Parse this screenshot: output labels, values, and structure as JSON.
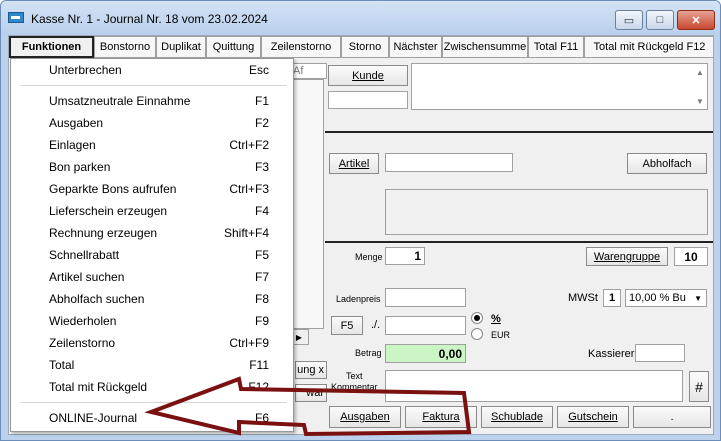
{
  "window": {
    "title": "Kasse Nr. 1  -  Journal Nr. 18 vom 23.02.2024",
    "min_glyph": "▭",
    "max_glyph": "□",
    "close_glyph": "✕"
  },
  "menubar": {
    "items": [
      "Funktionen",
      "Bonstorno",
      "Duplikat",
      "Quittung",
      "Zeilenstorno",
      "Storno",
      "Nächster",
      "Zwischensumme",
      "Total F11",
      "Total mit Rückgeld F12"
    ]
  },
  "form": {
    "kunde_button": "Kunde",
    "column_header_fragment": "Af",
    "artikel_button": "Artikel",
    "abholfach_button": "Abholfach",
    "menge_label": "Menge",
    "menge_value": "1",
    "warengruppe_button": "Warengruppe",
    "warengruppe_value": "10",
    "ladenpreis_label": "Ladenpreis",
    "mwst_label": "MWSt",
    "mwst_code": "1",
    "mwst_select": "10,00 % Bu",
    "f5_button": "F5",
    "divide_symbol": "./.",
    "percent_label": "%",
    "eur_label": "EUR",
    "betrag_label": "Betrag",
    "betrag_value": "0,00",
    "kassierer_label": "Kassierer",
    "text_kommentar_label": "Text\nKommentar",
    "hash_button": "#",
    "partial_button_1": "ung x",
    "partial_button_2": "war",
    "ausgaben_button": "Ausgaben",
    "faktura_button": "Faktura",
    "schublade_button": "Schublade",
    "gutschein_button": "Gutschein",
    "dot_button": "."
  },
  "menu": {
    "items": [
      {
        "label": "Unterbrechen",
        "shortcut": "Esc"
      },
      {
        "label": "Umsatzneutrale Einnahme",
        "shortcut": "F1"
      },
      {
        "label": "Ausgaben",
        "shortcut": "F2"
      },
      {
        "label": "Einlagen",
        "shortcut": "Ctrl+F2"
      },
      {
        "label": "Bon parken",
        "shortcut": "F3"
      },
      {
        "label": "Geparkte Bons aufrufen",
        "shortcut": "Ctrl+F3"
      },
      {
        "label": "Lieferschein erzeugen",
        "shortcut": "F4"
      },
      {
        "label": "Rechnung erzeugen",
        "shortcut": "Shift+F4"
      },
      {
        "label": "Schnellrabatt",
        "shortcut": "F5"
      },
      {
        "label": "Artikel suchen",
        "shortcut": "F7"
      },
      {
        "label": "Abholfach suchen",
        "shortcut": "F8"
      },
      {
        "label": "Wiederholen",
        "shortcut": "F9"
      },
      {
        "label": "Zeilenstorno",
        "shortcut": "Ctrl+F9"
      },
      {
        "label": "Total",
        "shortcut": "F11"
      },
      {
        "label": "Total mit Rückgeld",
        "shortcut": "F12"
      },
      {
        "label": "ONLINE-Journal",
        "shortcut": "F6"
      }
    ]
  },
  "colors": {
    "annotation_arrow": "#7a1010",
    "betrag_field": "#ccf5c6"
  }
}
